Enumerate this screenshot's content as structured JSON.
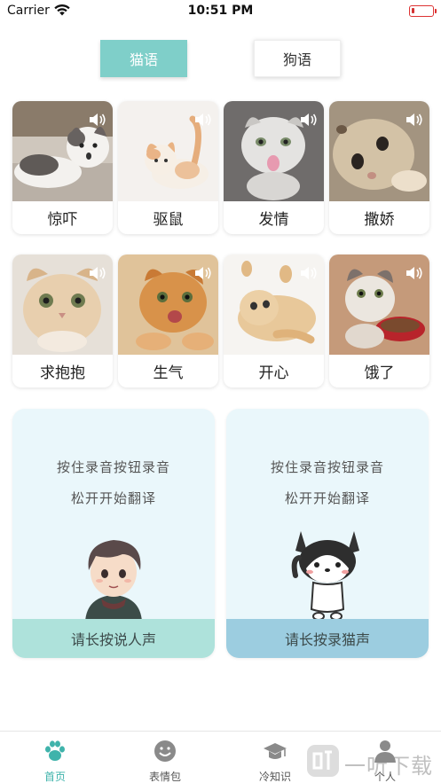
{
  "status_bar": {
    "carrier": "Carrier",
    "time": "10:51 PM",
    "battery_level": 0.15,
    "battery_color": "#d33333"
  },
  "segments": {
    "cat": "猫语",
    "dog": "狗语",
    "active": "cat",
    "accent": "#7fcfc9"
  },
  "cards": [
    {
      "label": "惊吓",
      "icon": "speaker-icon"
    },
    {
      "label": "驱鼠",
      "icon": "speaker-icon"
    },
    {
      "label": "发情",
      "icon": "speaker-icon"
    },
    {
      "label": "撒娇",
      "icon": "speaker-icon"
    },
    {
      "label": "求抱抱",
      "icon": "speaker-icon"
    },
    {
      "label": "生气",
      "icon": "speaker-icon"
    },
    {
      "label": "开心",
      "icon": "speaker-icon"
    },
    {
      "label": "饿了",
      "icon": "speaker-icon"
    }
  ],
  "panels": {
    "human": {
      "line1": "按住录音按钮录音",
      "line2": "松开开始翻译",
      "action": "请长按说人声",
      "action_color": "#aee2db"
    },
    "cat": {
      "line1": "按住录音按钮录音",
      "line2": "松开开始翻译",
      "action": "请长按录猫声",
      "action_color": "#9ccde0"
    }
  },
  "tabs": [
    {
      "label": "首页",
      "icon": "paw-icon",
      "active": true
    },
    {
      "label": "表情包",
      "icon": "smiley-icon",
      "active": false
    },
    {
      "label": "冷知识",
      "icon": "graduation-cap-icon",
      "active": false
    },
    {
      "label": "个人",
      "icon": "person-icon",
      "active": false
    }
  ],
  "watermark": {
    "text": "一听下载",
    "icon": "ting-logo-icon"
  }
}
